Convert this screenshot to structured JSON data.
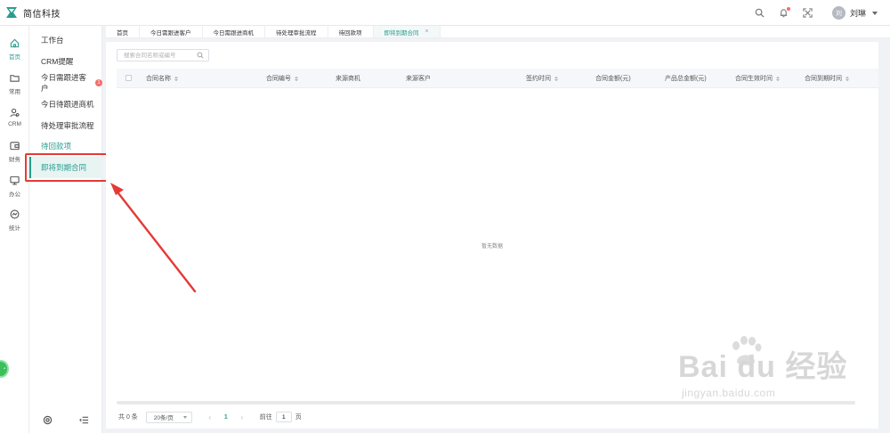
{
  "app": {
    "brand": "简信科技"
  },
  "user": {
    "avatar_initial": "刘",
    "name": "刘琳"
  },
  "rail": [
    {
      "label": "首页",
      "icon": "home-icon"
    },
    {
      "label": "常用",
      "icon": "folder-icon"
    },
    {
      "label": "CRM",
      "icon": "person-icon"
    },
    {
      "label": "财务",
      "icon": "finance-icon"
    },
    {
      "label": "办公",
      "icon": "monitor-icon"
    },
    {
      "label": "统计",
      "icon": "stats-icon"
    }
  ],
  "submenu": [
    {
      "label": "工作台"
    },
    {
      "label": "CRM提醒"
    },
    {
      "label": "今日需跟进客户",
      "badge": "1"
    },
    {
      "label": "今日待跟进商机"
    },
    {
      "label": "待处理审批流程"
    },
    {
      "label": "待回款项"
    },
    {
      "label": "即将到期合同"
    }
  ],
  "tabs": [
    {
      "label": "首页"
    },
    {
      "label": "今日需跟进客户"
    },
    {
      "label": "今日需跟进商机"
    },
    {
      "label": "待处理审批流程"
    },
    {
      "label": "待回款项"
    },
    {
      "label": "即将到期合同",
      "close": "×"
    }
  ],
  "search": {
    "placeholder": "搜索合同名称或编号"
  },
  "table": {
    "columns": [
      {
        "label": "合同名称",
        "sortable": true
      },
      {
        "label": "合同编号",
        "sortable": true
      },
      {
        "label": "来源商机",
        "sortable": false
      },
      {
        "label": "来源客户",
        "sortable": false
      },
      {
        "label": "签约时间",
        "sortable": true
      },
      {
        "label": "合同金额(元)",
        "sortable": false
      },
      {
        "label": "产品总金额(元)",
        "sortable": false
      },
      {
        "label": "合同生效时间",
        "sortable": true
      },
      {
        "label": "合同到期时间",
        "sortable": true
      }
    ],
    "empty_text": "暂无数据"
  },
  "pagination": {
    "total": "共 0 条",
    "page_size": "20条/页",
    "prev": "‹",
    "current_page": "1",
    "next": "›",
    "goto_label": "前往",
    "goto_value": "1",
    "goto_suffix": "页"
  },
  "watermark": {
    "text": "Bai du 经验",
    "url": "jingyan.baidu.com"
  },
  "colors": {
    "accent": "#2a9d8f",
    "annotation": "#e53935",
    "badge": "#f56c6c"
  }
}
